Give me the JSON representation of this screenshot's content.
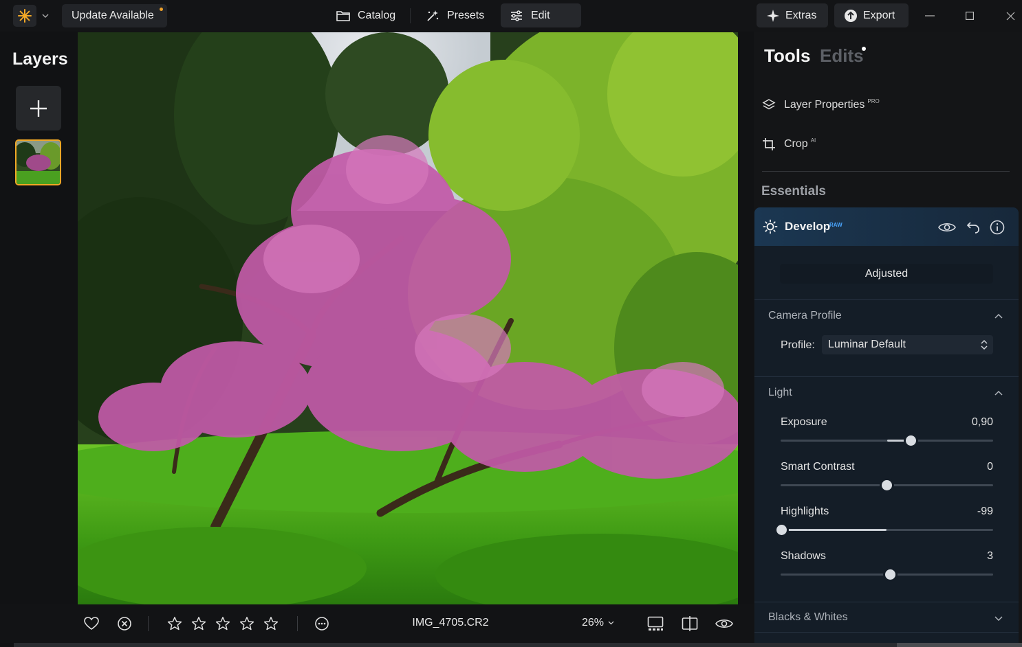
{
  "topbar": {
    "update_label": "Update Available",
    "accent_color": "#f2a826",
    "nav": [
      {
        "label": "Catalog",
        "icon": "folder-icon"
      },
      {
        "label": "Presets",
        "icon": "sparkle-wand-icon"
      },
      {
        "label": "Edit",
        "icon": "sliders-icon",
        "active": true
      }
    ],
    "extras_label": "Extras",
    "export_label": "Export"
  },
  "layers": {
    "title": "Layers"
  },
  "image": {
    "filename": "IMG_4705.CR2",
    "zoom": "26%",
    "rating_stars": 5,
    "rating_value": 0
  },
  "panel": {
    "tab_tools": "Tools",
    "tab_edits": "Edits",
    "tools": [
      {
        "label": "Layer Properties",
        "badge": "PRO",
        "icon": "layers-icon"
      },
      {
        "label": "Crop",
        "badge": "AI",
        "icon": "crop-icon"
      }
    ],
    "section_essentials": "Essentials",
    "develop": {
      "title": "Develop",
      "badge": "RAW",
      "status": "Adjusted",
      "camera_profile": {
        "title": "Camera Profile",
        "profile_label": "Profile:",
        "profile_value": "Luminar Default"
      },
      "light": {
        "title": "Light",
        "sliders": [
          {
            "label": "Exposure",
            "value": "0,90",
            "min": -4,
            "max": 4,
            "num": 0.9
          },
          {
            "label": "Smart Contrast",
            "value": "0",
            "min": -100,
            "max": 100,
            "num": 0
          },
          {
            "label": "Highlights",
            "value": "-99",
            "min": -100,
            "max": 100,
            "num": -99
          },
          {
            "label": "Shadows",
            "value": "3",
            "min": -100,
            "max": 100,
            "num": 3
          }
        ]
      },
      "blacks_whites": {
        "title": "Blacks & Whites"
      }
    }
  }
}
